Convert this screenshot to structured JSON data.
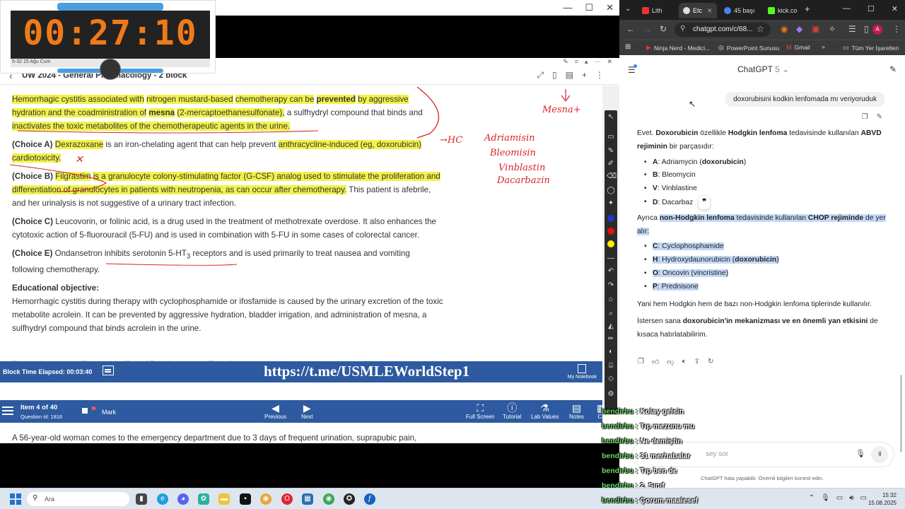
{
  "timer": {
    "digits": "00:27:10",
    "mini_label": "5-32",
    "strip_text": "5-32  15 Ağu Cum"
  },
  "uworld": {
    "title": "UW 2024 - General Pharmacology - 2 block",
    "back_icon": "‹",
    "p1": {
      "a": "Hemorrhagic cystitis associated with",
      "b": "nitrogen mustard-based",
      "c": "chemotherapy can be",
      "d": "prevented",
      "e": "by aggressive hydration and the coadministration of",
      "f": "mesna",
      "g": "(2-mercaptoethanesulfonate),",
      "h": "a sulfhydryl compound that binds and",
      "i": "inactivates the toxic metabolites of the chemotherapeutic agents in the urine."
    },
    "choiceA": {
      "label": "(Choice A)",
      "drug": "Dexrazoxane",
      "a": "is an iron-chelating agent that can help prevent",
      "b": "anthracycline-induced (eg, doxorubicin)",
      "c": "cardiotoxicity."
    },
    "choiceB": {
      "label": "(Choice B)",
      "drug": "Filgrastim",
      "a": "is a granulocyte colony-stimulating factor (G-CSF) analog used to stimulate the proliferation and differentiation of granulocytes in patients with neutropenia, as can occur after chemotherapy.",
      "b": "This patient is afebrile, and her urinalysis is not suggestive of a urinary tract infection."
    },
    "choiceC": {
      "label": "(Choice C)",
      "text": "Leucovorin, or folinic acid, is a drug used in the treatment of methotrexate overdose.  It also enhances the cytotoxic action of 5-fluorouracil (5-FU) and is used in combination with 5-FU in some cases of colorectal cancer."
    },
    "choiceE": {
      "label": "(Choice E)",
      "a": "Ondansetron inhibits serotonin 5-HT",
      "sub": "3",
      "b": "receptors and is used primarily to treat nausea and vomiting following chemotherapy."
    },
    "objective": {
      "title": "Educational objective:",
      "text": "Hemorrhagic cystitis during therapy with cyclophosphamide or ifosfamide is caused by the urinary excretion of the toxic metabolite acrolein.  It can be prevented by aggressive hydration, bladder irrigation, and administration of mesna, a sulfhydryl compound that binds acrolein in the urine."
    },
    "faded_tabs": [
      "Pharmacology",
      "Pharmacology (General Principles)",
      "Chemotherapy"
    ],
    "handwriting": {
      "mesna": "Mesna+",
      "hc": "→HC",
      "abvd": [
        "Adriamisin",
        "Bleomisin",
        "Vinblastin",
        "Dacarbazin"
      ],
      "x": "✕"
    },
    "block_elapsed": "Block Time Elapsed: 00:03:40",
    "telegram_link": "https://t.me/USMLEWorldStep1",
    "notebook_label": "My Notebook",
    "item_of": "Item 4 of 40",
    "question_id": "Question Id: 1816",
    "mark_label": "Mark",
    "nav": {
      "previous": "Previous",
      "next": "Next",
      "full_screen": "Full Screen",
      "tutorial": "Tutorial",
      "lab_values": "Lab Values",
      "notes": "Notes",
      "calc": "Ca"
    },
    "question_text": "A 56-year-old woman comes to the emergency department due to 3 days of frequent urination, suprapubic pain,"
  },
  "browser": {
    "tabs": [
      {
        "label": "Lith",
        "color": "#e33"
      },
      {
        "label": "Etc",
        "color": "#ddd"
      },
      {
        "label": "45 başı",
        "color": "#4285f4"
      },
      {
        "label": "kick.co",
        "color": "#53fc18"
      }
    ],
    "new_tab": "+",
    "url": "chatgpt.com/c/68...",
    "profile_letter": "A",
    "bookmarks": [
      {
        "label": "Ninja Nerd - Medici...",
        "icon": "▶"
      },
      {
        "label": "PowerPoint Sunusu",
        "icon": "◎"
      },
      {
        "label": "Gmail",
        "icon": "M"
      }
    ],
    "bookmarks_more": "»",
    "all_bookmarks": "Tüm Yer İşaretleri"
  },
  "chatgpt": {
    "title": "ChatGPT",
    "version": "5",
    "user_message": "doxorubisini kodkin lenfomada mı veriyoruduk",
    "r1": {
      "a": "Evet.",
      "b": "Doxorubicin",
      "c": "özellikle",
      "d": "Hodgkin lenfoma",
      "e": "tedavisinde kullanılan",
      "f": "ABVD rejiminin",
      "g": "bir parçasıdır:"
    },
    "abvd": [
      {
        "k": "A",
        "v": "Adriamycin (",
        "bold": "doxorubicin",
        "end": ")"
      },
      {
        "k": "B",
        "v": "Bleomycin",
        "bold": "",
        "end": ""
      },
      {
        "k": "V",
        "v": "Vinblastine",
        "bold": "",
        "end": ""
      },
      {
        "k": "D",
        "v": "Dacarbaz",
        "bold": "",
        "end": ""
      }
    ],
    "quote_glyph": "❞",
    "r2": {
      "a": "Ayrıca",
      "b": "non-Hodgkin lenfoma",
      "c": "tedavisinde kullanılan",
      "d": "CHOP rejiminde",
      "e": "de yer alır:"
    },
    "chop": [
      {
        "k": "C",
        "v": "Cyclophosphamide",
        "bold": "",
        "end": ""
      },
      {
        "k": "H",
        "v": "Hydroxydaunorubicin (",
        "bold": "doxorubicin",
        "end": ")"
      },
      {
        "k": "O",
        "v": "Oncovin (vincristine)",
        "bold": "",
        "end": ""
      },
      {
        "k": "P",
        "v": "Prednisone",
        "bold": "",
        "end": ""
      }
    ],
    "r3": "Yani hem Hodgkin hem de bazı non-Hodgkin lenfoma tiplerinde kullanılır.",
    "r4": {
      "a": "İstersen sana",
      "b": "doxorubicin'in mekanizması ve en önemli yan etkisini",
      "c": "de kısaca hatırlatabilirim."
    },
    "composer_placeholder": "sey sor",
    "disclaimer": "ChatGPT hata yapabilir. Önemli bilgileri kontrol edin."
  },
  "chat_overlay": [
    {
      "user": "bendirbu",
      "msg": "Kolay gelsin"
    },
    {
      "user": "bendirbu",
      "msg": "Tıp mezunu mu"
    },
    {
      "user": "bendirbu",
      "msg": "Ne demiştin"
    },
    {
      "user": "bendirbu",
      "msg": "31 merhabalar"
    },
    {
      "user": "bendirbu",
      "msg": "Tıp ben de"
    },
    {
      "user": "bendirbu",
      "msg": "2. Sınıf"
    },
    {
      "user": "bendirbu",
      "msg": "Çorum maalesef"
    }
  ],
  "taskbar": {
    "search_placeholder": "Ara",
    "time": "15:32",
    "date": "15.08.2025"
  }
}
